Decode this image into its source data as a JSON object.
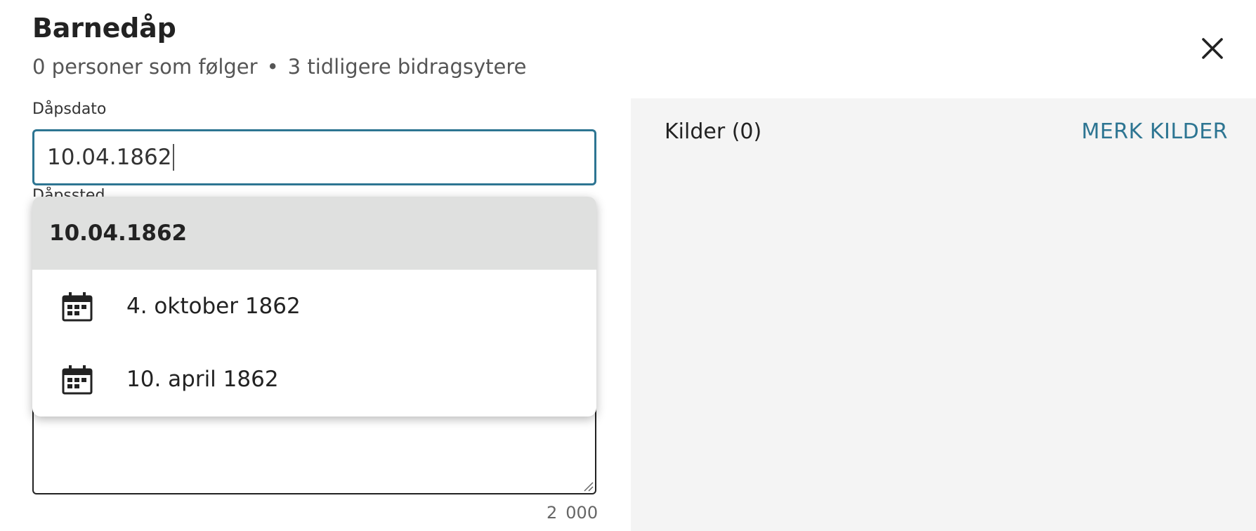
{
  "header": {
    "title": "Barnedåp",
    "followers": "0 personer som følger",
    "separator": "•",
    "contributors": "3 tidligere bidragsytere"
  },
  "form": {
    "date_label": "Dåpsdato",
    "date_value": "10.04.1862",
    "place_label": "Dåpssted",
    "char_count_a": "2",
    "char_count_b": "000"
  },
  "suggestions": {
    "typed": "10.04.1862",
    "items": [
      {
        "label": "4. oktober 1862",
        "icon": "calendar-icon"
      },
      {
        "label": "10. april 1862",
        "icon": "calendar-icon"
      }
    ]
  },
  "sources": {
    "title": "Kilder (0)",
    "action": "MERK KILDER"
  },
  "colors": {
    "accent": "#2d7592",
    "panel_bg": "#f4f4f4",
    "highlight": "#dfe0df"
  }
}
